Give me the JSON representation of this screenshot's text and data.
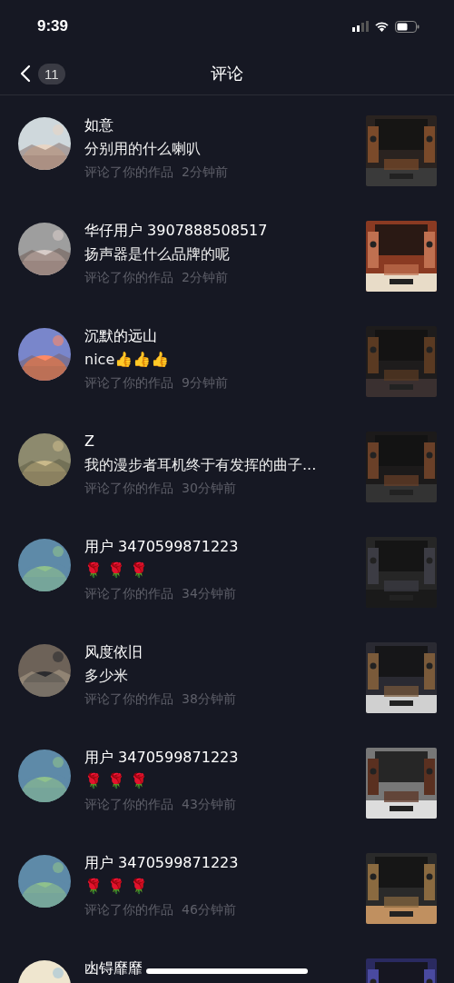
{
  "status_bar": {
    "time": "9:39"
  },
  "header": {
    "back_count": "11",
    "title": "评论"
  },
  "comments": [
    {
      "user": "如意",
      "text": "分别用的什么喇叭",
      "action": "评论了你的作品",
      "time": "2分钟前"
    },
    {
      "user": "华仔用户 3907888508517",
      "text": "扬声器是什么品牌的呢",
      "action": "评论了你的作品",
      "time": "2分钟前"
    },
    {
      "user": "沉默的远山",
      "text": "nice👍👍👍",
      "action": "评论了你的作品",
      "time": "9分钟前"
    },
    {
      "user": "Z",
      "text": "我的漫步者耳机终于有发挥的曲子...",
      "action": "评论了你的作品",
      "time": "30分钟前"
    },
    {
      "user": "用户 3470599871223",
      "text": "🌹 🌹 🌹",
      "action": "评论了你的作品",
      "time": "34分钟前"
    },
    {
      "user": "风度依旧",
      "text": "多少米",
      "action": "评论了你的作品",
      "time": "38分钟前"
    },
    {
      "user": "用户 3470599871223",
      "text": "🌹 🌹 🌹",
      "action": "评论了你的作品",
      "time": "43分钟前"
    },
    {
      "user": "用户 3470599871223",
      "text": "🌹 🌹 🌹",
      "action": "评论了你的作品",
      "time": "46分钟前"
    },
    {
      "user": "凼锝靡靡"
    }
  ]
}
